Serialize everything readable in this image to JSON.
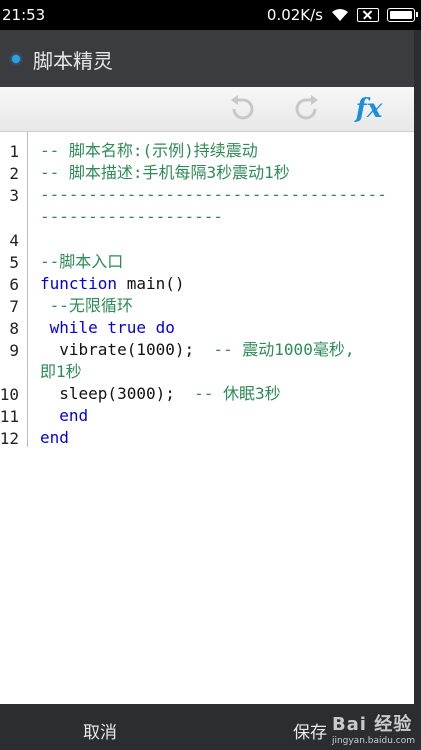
{
  "status_bar": {
    "time": "21:53",
    "network_speed": "0.02K/s",
    "icons": [
      "wifi-icon",
      "sim-none-icon",
      "battery-icon"
    ]
  },
  "app": {
    "title": "脚本精灵",
    "accent": "#29a3e3"
  },
  "toolbar": {
    "undo_icon": "undo-icon",
    "redo_icon": "redo-icon",
    "fx_label": "fx"
  },
  "editor": {
    "line_numbers": [
      "1",
      "2",
      "3",
      "4",
      "5",
      "6",
      "7",
      "8",
      "9",
      "10",
      "11",
      "12"
    ],
    "lines": [
      {
        "text": "-- 脚本名称:(示例)持续震动",
        "kind": "comment"
      },
      {
        "text": "-- 脚本描述:手机每隔3秒震动1秒",
        "kind": "comment"
      },
      {
        "text": "------------------------------------",
        "kind": "comment"
      },
      {
        "text": "-------------------",
        "kind": "comment"
      },
      {
        "text": "--脚本入口",
        "kind": "comment"
      },
      {
        "kw": "function",
        "rest": " main()"
      },
      {
        "text": " --无限循环",
        "kind": "comment"
      },
      {
        "kw1": " while",
        "kw2": " true",
        "kw3": " do"
      },
      {
        "code": "  vibrate(1000);",
        "comment": "  -- 震动1000毫秒,"
      },
      {
        "text": "即1秒",
        "kind": "comment"
      },
      {
        "code": "  sleep(3000);",
        "comment": "  -- 休眠3秒"
      },
      {
        "kw": "  end"
      },
      {
        "kw": "end"
      }
    ]
  },
  "bottom_bar": {
    "cancel_label": "取消",
    "save_label": "保存",
    "watermark": "Bai 经验",
    "watermark_url": "jingyan.baidu.com"
  }
}
